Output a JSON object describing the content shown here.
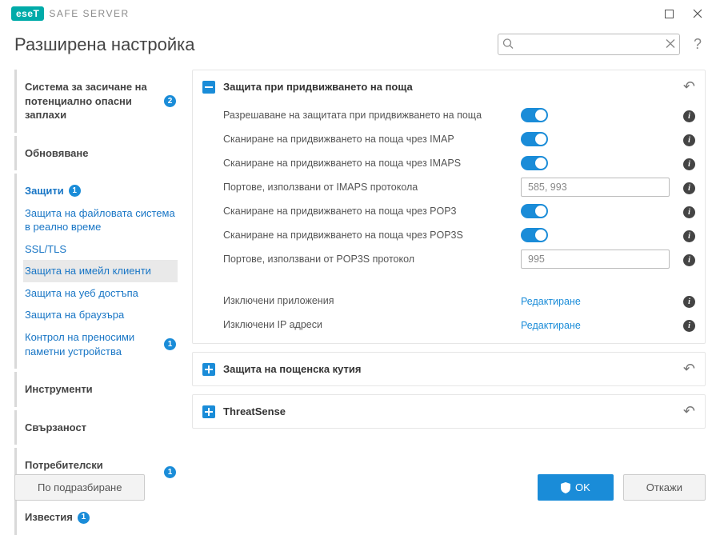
{
  "titlebar": {
    "brand_mark": "eseT",
    "brand_text": "SAFE SERVER"
  },
  "header": {
    "title": "Разширена настройка",
    "search_placeholder": ""
  },
  "sidebar": {
    "g0": {
      "i0": {
        "label": "Система за засичане на потенциално опасни заплахи",
        "badge": "2"
      }
    },
    "g1": {
      "i0": {
        "label": "Обновяване"
      }
    },
    "g2": {
      "i0": {
        "label": "Защити",
        "badge": "1"
      },
      "i1": {
        "label": "Защита на файловата система в реално време"
      },
      "i2": {
        "label": "SSL/TLS"
      },
      "i3": {
        "label": "Защита на имейл клиенти"
      },
      "i4": {
        "label": "Защита на уеб достъпа"
      },
      "i5": {
        "label": "Защита на браузъра"
      },
      "i6": {
        "label": "Контрол на преносими паметни устройства",
        "badge": "1"
      }
    },
    "g3": {
      "i0": {
        "label": "Инструменти"
      }
    },
    "g4": {
      "i0": {
        "label": "Свързаност"
      }
    },
    "g5": {
      "i0": {
        "label": "Потребителски интерфейс",
        "badge": "1"
      }
    },
    "g6": {
      "i0": {
        "label": "Известия",
        "badge": "1"
      }
    }
  },
  "panels": {
    "p0": {
      "title": "Защита при придвижването на поща",
      "rows": {
        "r0": {
          "label": "Разрешаване на защитата при придвижването на поща"
        },
        "r1": {
          "label": "Сканиране на придвижването на поща чрез IMAP"
        },
        "r2": {
          "label": "Сканиране на придвижването на поща чрез IMAPS"
        },
        "r3": {
          "label": "Портове, използвани от IMAPS протокола",
          "value": "585, 993"
        },
        "r4": {
          "label": "Сканиране на придвижването на поща чрез POP3"
        },
        "r5": {
          "label": "Сканиране на придвижването на поща чрез POP3S"
        },
        "r6": {
          "label": "Портове, използвани от POP3S протокол",
          "value": "995"
        },
        "r7": {
          "label": "Изключени приложения",
          "action": "Редактиране"
        },
        "r8": {
          "label": "Изключени IP адреси",
          "action": "Редактиране"
        }
      }
    },
    "p1": {
      "title": "Защита на пощенска кутия"
    },
    "p2": {
      "title": "ThreatSense"
    }
  },
  "footer": {
    "default": "По подразбиране",
    "ok": "OK",
    "cancel": "Откажи"
  }
}
